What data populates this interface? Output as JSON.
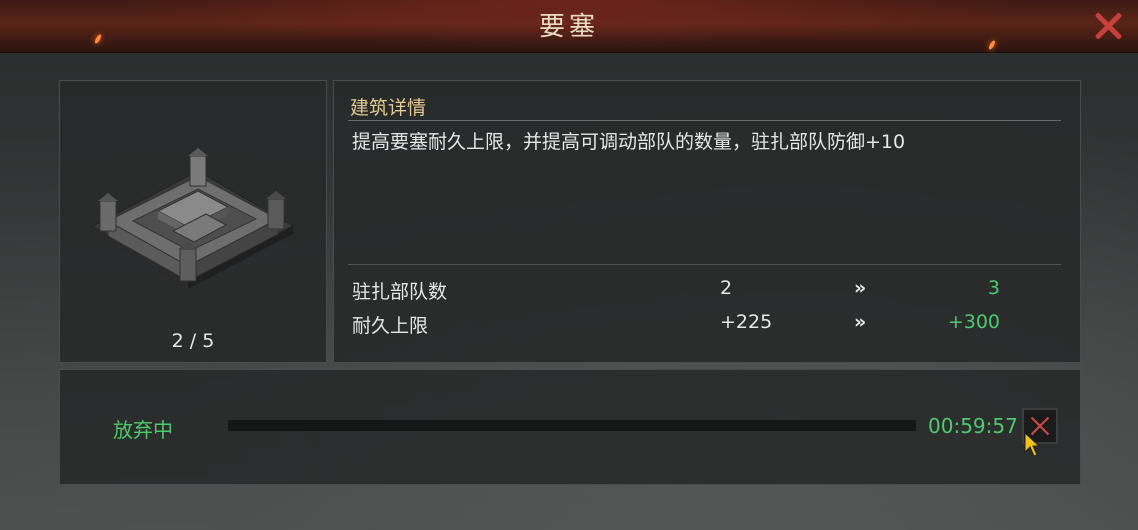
{
  "header": {
    "title": "要塞",
    "close_icon": "close-icon"
  },
  "building": {
    "image_icon": "fortress-icon",
    "level": "2 / 5"
  },
  "details": {
    "section_title": "建筑详情",
    "description": "提高要塞耐久上限，并提高可调动部队的数量，驻扎部队防御+10",
    "stats": [
      {
        "label": "驻扎部队数",
        "current": "2",
        "arrow": "»",
        "next": "3"
      },
      {
        "label": "耐久上限",
        "current": "+225",
        "arrow": "»",
        "next": "+300"
      }
    ]
  },
  "progress": {
    "status": "放弃中",
    "timer": "00:59:57",
    "progress_fraction": 0,
    "cancel_icon": "close-icon"
  },
  "colors": {
    "accent_green": "#4ec96c",
    "title_gold": "#e2c98f",
    "close_red": "#c8403a"
  }
}
